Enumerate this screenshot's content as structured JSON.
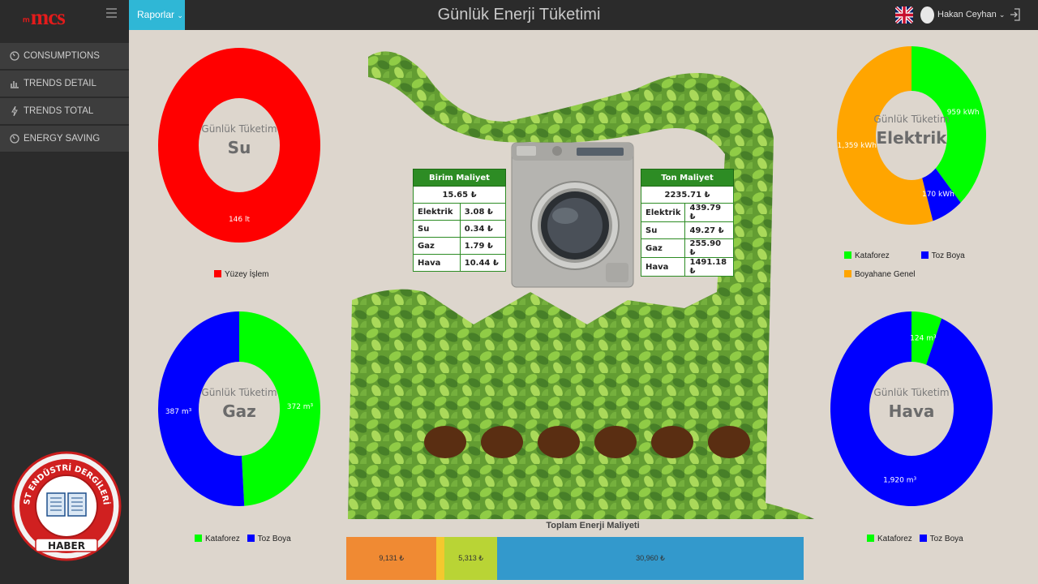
{
  "app": {
    "logo": "mcs",
    "title": "Günlük Enerji Tüketimi",
    "reports_menu": "Raporlar",
    "user_name": "Hakan Ceyhan"
  },
  "sidebar": {
    "items": [
      {
        "label": "CONSUMPTIONS",
        "icon": "gauge-icon"
      },
      {
        "label": "TRENDS DETAIL",
        "icon": "bar-chart-icon"
      },
      {
        "label": "TRENDS TOTAL",
        "icon": "bolt-icon"
      },
      {
        "label": "ENERGY SAVING",
        "icon": "gauge-icon"
      }
    ]
  },
  "stamp": {
    "text": "ST ENDÜSTRİ DERGİLERİ",
    "bottom": "HABER"
  },
  "colors": {
    "green": "#00ff00",
    "blue": "#0000ff",
    "red": "#ff0000",
    "orange": "#ffa500",
    "accent": "#2fb7d6"
  },
  "chart_data": [
    {
      "type": "pie",
      "subtitle": "Günlük Tüketim",
      "title": "Su",
      "series": [
        {
          "name": "Yüzey İşlem",
          "value": 146,
          "label": "146 lt",
          "color": "#ff0000"
        }
      ]
    },
    {
      "type": "pie",
      "subtitle": "Günlük Tüketim",
      "title": "Elektrik",
      "series": [
        {
          "name": "Kataforez",
          "value": 959,
          "label": "959 kWh",
          "color": "#00ff00"
        },
        {
          "name": "Toz Boya",
          "value": 170,
          "label": "170 kWh",
          "color": "#0000ff"
        },
        {
          "name": "Boyahane Genel",
          "value": 1359,
          "label": "1,359 kWh",
          "color": "#ffa500"
        }
      ]
    },
    {
      "type": "pie",
      "subtitle": "Günlük Tüketim",
      "title": "Gaz",
      "series": [
        {
          "name": "Kataforez",
          "value": 372,
          "label": "372 m³",
          "color": "#00ff00"
        },
        {
          "name": "Toz Boya",
          "value": 387,
          "label": "387 m³",
          "color": "#0000ff"
        }
      ]
    },
    {
      "type": "pie",
      "subtitle": "Günlük Tüketim",
      "title": "Hava",
      "series": [
        {
          "name": "Kataforez",
          "value": 124,
          "label": "124 m³",
          "color": "#00ff00"
        },
        {
          "name": "Toz Boya",
          "value": 1920,
          "label": "1,920 m³",
          "color": "#0000ff"
        }
      ]
    },
    {
      "type": "bar",
      "title": "Toplam Enerji Maliyeti",
      "segments": [
        {
          "value": 9131,
          "label": "9,131 ₺",
          "color": "#f08a33"
        },
        {
          "value": 800,
          "label": "",
          "color": "#f4c82e"
        },
        {
          "value": 5313,
          "label": "5,313 ₺",
          "color": "#b9d435"
        },
        {
          "value": 30960,
          "label": "30,960 ₺",
          "color": "#3399cc"
        }
      ]
    }
  ],
  "unit_cost": {
    "header": "Birim Maliyet",
    "total": "15.65 ₺",
    "rows": [
      {
        "name": "Elektrik",
        "value": "3.08 ₺"
      },
      {
        "name": "Su",
        "value": "0.34 ₺"
      },
      {
        "name": "Gaz",
        "value": "1.79 ₺"
      },
      {
        "name": "Hava",
        "value": "10.44 ₺"
      }
    ]
  },
  "ton_cost": {
    "header": "Ton Maliyet",
    "total": "2235.71 ₺",
    "rows": [
      {
        "name": "Elektrik",
        "value": "439.79 ₺"
      },
      {
        "name": "Su",
        "value": "49.27 ₺"
      },
      {
        "name": "Gaz",
        "value": "255.90 ₺"
      },
      {
        "name": "Hava",
        "value": "1491.18 ₺"
      }
    ]
  }
}
